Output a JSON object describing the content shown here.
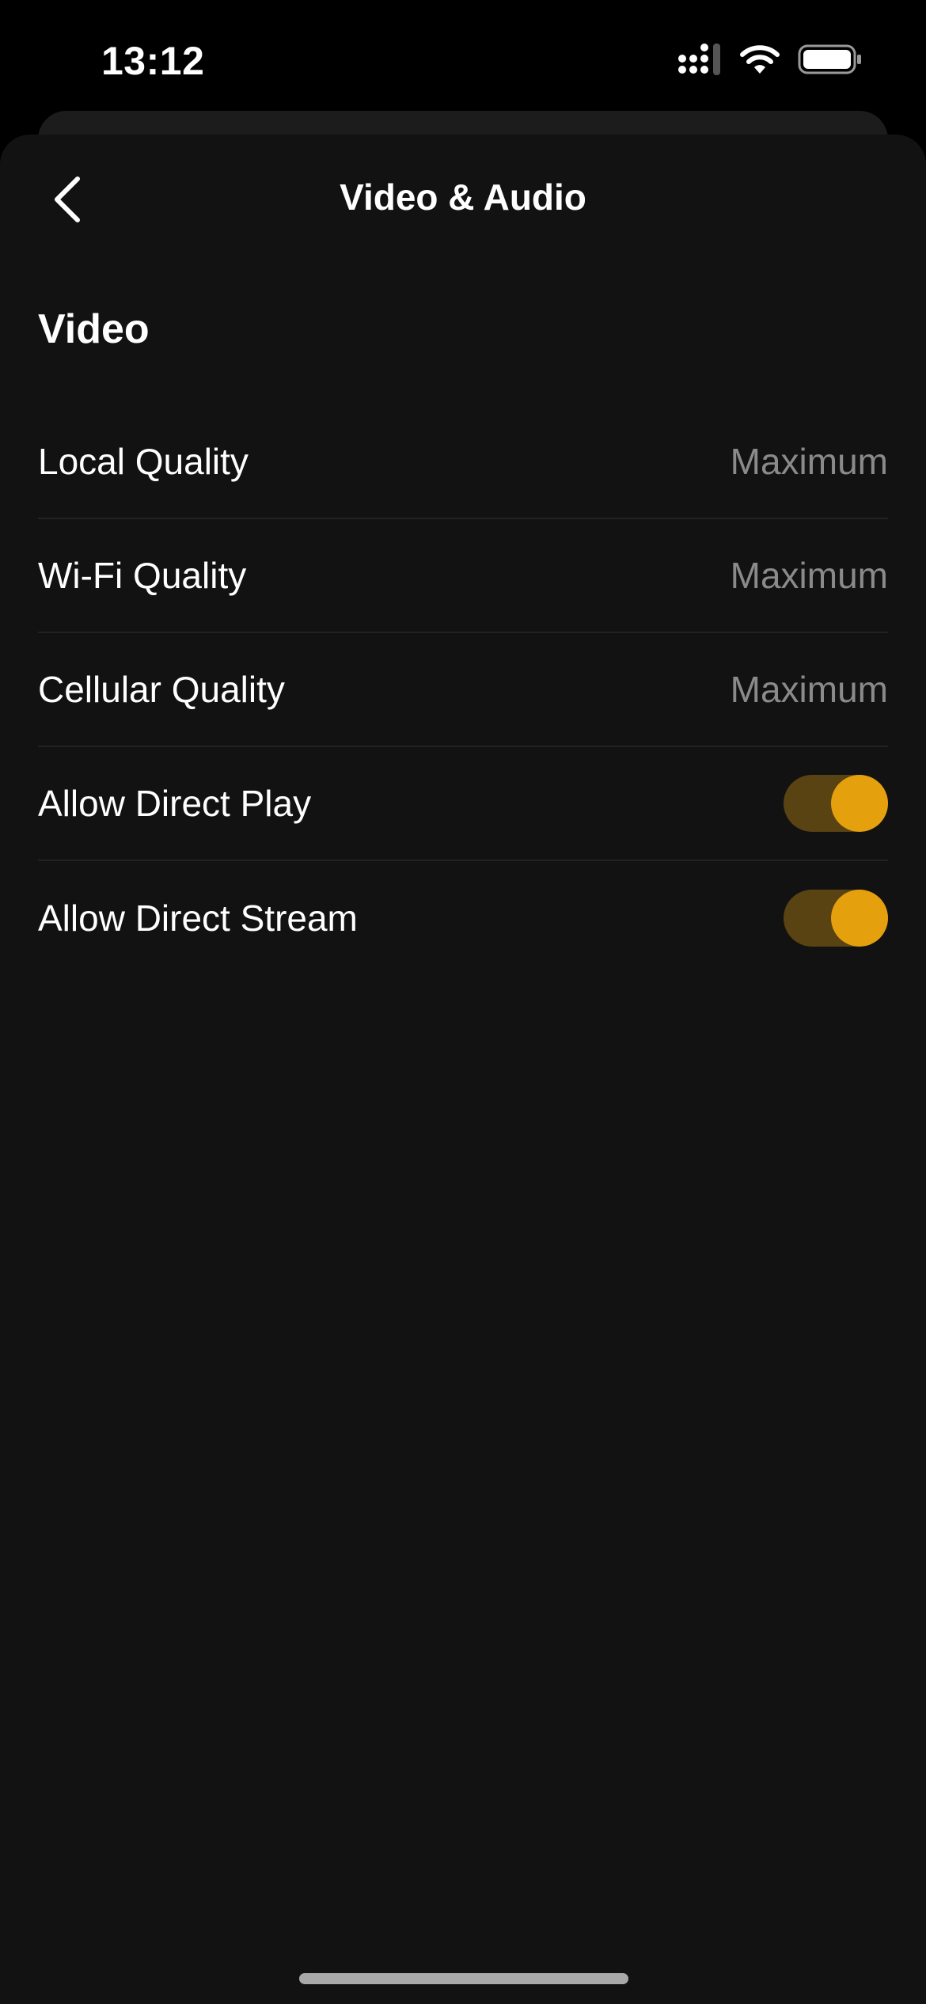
{
  "status_bar": {
    "time": "13:12",
    "icons": [
      "cellular-signal-icon",
      "wifi-icon",
      "battery-icon"
    ]
  },
  "nav": {
    "title": "Video & Audio",
    "back_icon": "chevron-left-icon"
  },
  "section": {
    "title": "Video"
  },
  "rows": [
    {
      "label": "Local Quality",
      "value": "Maximum"
    },
    {
      "label": "Wi-Fi Quality",
      "value": "Maximum"
    },
    {
      "label": "Cellular Quality",
      "value": "Maximum"
    },
    {
      "label": "Allow Direct Play",
      "toggle_on": true
    },
    {
      "label": "Allow Direct Stream",
      "toggle_on": true
    }
  ],
  "colors": {
    "background": "#121212",
    "accent": "#e5a00d",
    "toggle_track": "#5a4312",
    "secondary_text": "#8a8a8a",
    "divider": "#222222"
  }
}
